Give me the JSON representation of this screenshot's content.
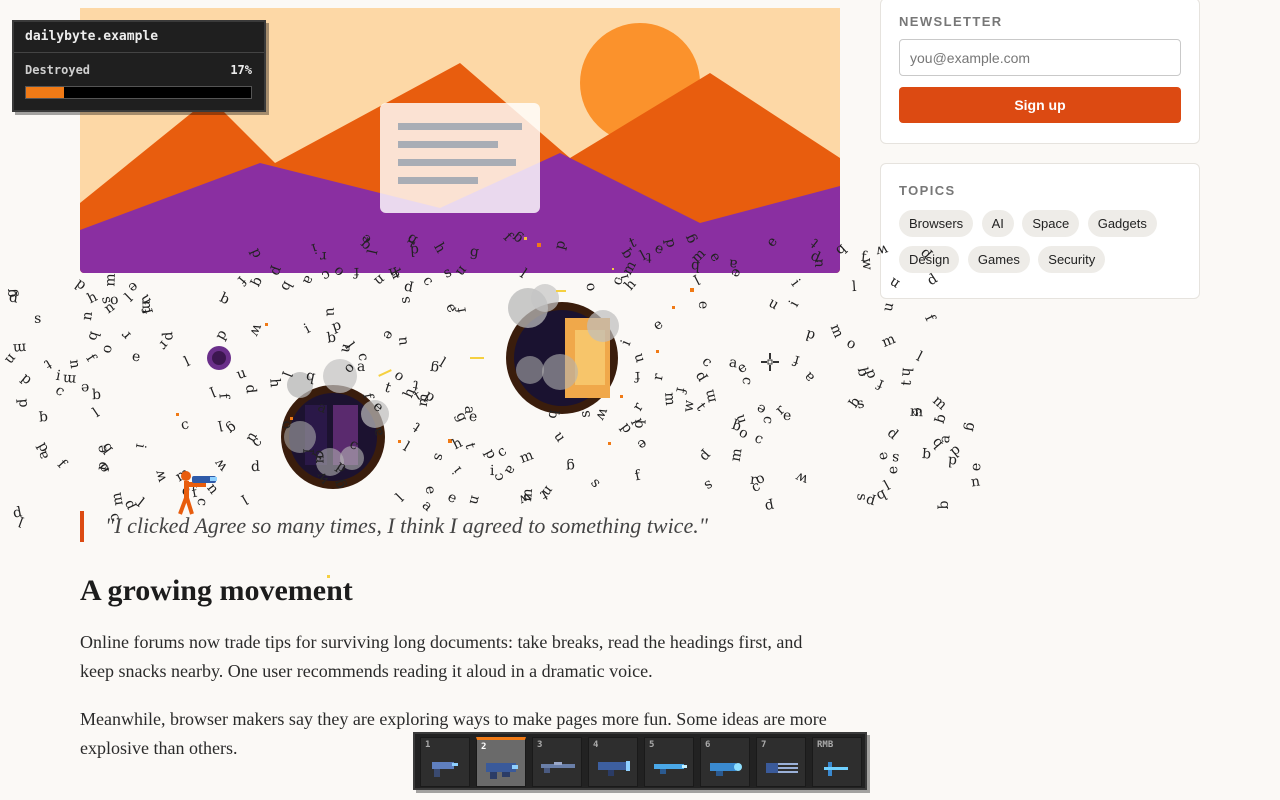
{
  "hud": {
    "domain": "dailybyte.example",
    "label": "Destroyed",
    "percent_text": "17%",
    "progress": 0.17
  },
  "sidebar": {
    "newsletter": {
      "title": "NEWSLETTER",
      "email_placeholder": "you@example.com",
      "button_label": "Sign up"
    },
    "topics": {
      "title": "TOPICS",
      "items": [
        "Browsers",
        "AI",
        "Space",
        "Gadgets",
        "Design",
        "Games",
        "Security"
      ]
    }
  },
  "article": {
    "quote": "\"I clicked Agree so many times, I think I agreed to something twice.\"",
    "heading": "A growing movement",
    "paragraphs": [
      "Online forums now trade tips for surviving long documents: take breaks, read the headings first, and keep snacks nearby. One user recommends reading it aloud in a dramatic voice.",
      "Meanwhile, browser makers say they are exploring ways to make pages more fun. Some ideas are more explosive than others."
    ]
  },
  "weapons": {
    "slots": [
      "1",
      "2",
      "3",
      "4",
      "5",
      "6",
      "7",
      "RMB"
    ],
    "active_index": 1
  },
  "colors": {
    "accent": "#dc4a12",
    "hud_fill": "#f07a16",
    "hero_bg": "#fdd8a6",
    "mountain_orange": "#e85d0e",
    "mountain_purple": "#8a2fa1",
    "sun": "#fb922c"
  },
  "icons": [
    "crosshair-icon",
    "player-sprite",
    "explosion-crater",
    "blaster-icon",
    "shotgun-icon",
    "rifle-icon",
    "laser-icon",
    "plasma-icon",
    "minigun-icon",
    "beam-icon"
  ]
}
